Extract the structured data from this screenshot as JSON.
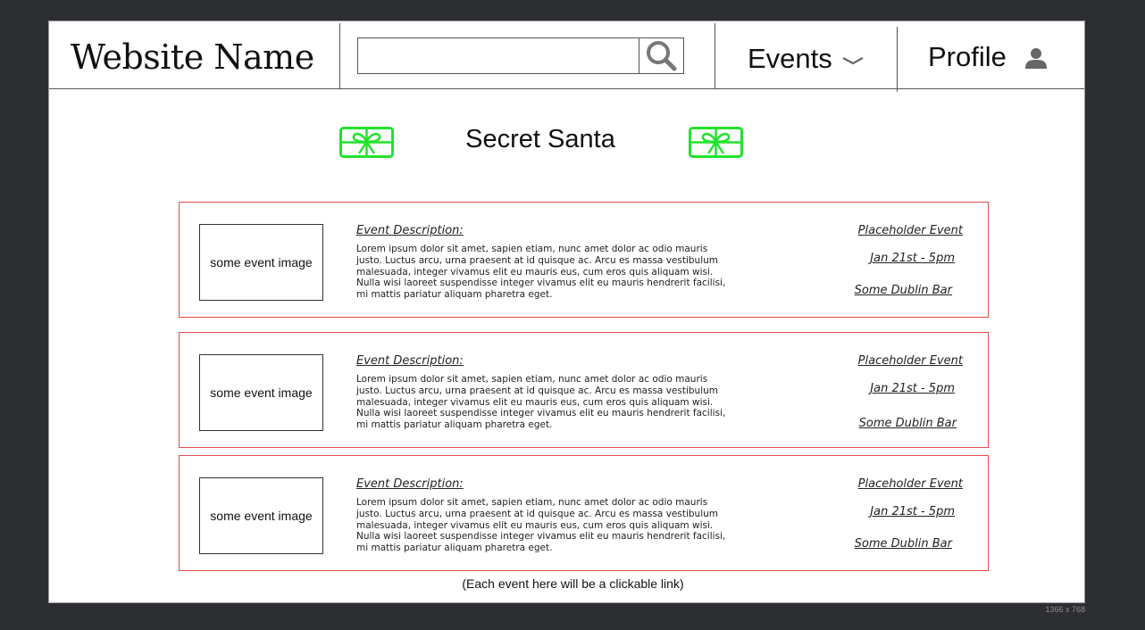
{
  "header": {
    "site_name": "Website Name",
    "search": {
      "value": "",
      "placeholder": "",
      "icon": "search-icon"
    },
    "events_label": "Events",
    "events_icon": "chevron-down-icon",
    "profile_label": "Profile",
    "profile_icon": "person-icon"
  },
  "hero": {
    "title": "Secret Santa",
    "icon": "gift-icon",
    "icon_color": "#22e32c"
  },
  "events": [
    {
      "image_label": "some event image",
      "description_title": "Event Description:",
      "description": "Lorem ipsum dolor sit amet, sapien etiam, nunc amet dolor ac odio mauris justo. Luctus arcu, urna praesent at id quisque ac. Arcu es massa vestibulum malesuada, integer vivamus elit eu mauris eus, cum eros quis aliquam wisi. Nulla wisi laoreet suspendisse integer vivamus elit eu mauris hendrerit facilisi, mi mattis pariatur aliquam pharetra eget.",
      "name": "Placeholder Event",
      "date": "Jan 21st - 5pm",
      "venue": "Some Dublin Bar"
    },
    {
      "image_label": "some event image",
      "description_title": "Event Description:",
      "description": "Lorem ipsum dolor sit amet, sapien etiam, nunc amet dolor ac odio mauris justo. Luctus arcu, urna praesent at id quisque ac. Arcu es massa vestibulum malesuada, integer vivamus elit eu mauris eus, cum eros quis aliquam wisi. Nulla wisi laoreet suspendisse integer vivamus elit eu mauris hendrerit facilisi, mi mattis pariatur aliquam pharetra eget.",
      "name": "Placeholder Event",
      "date": "Jan 21st - 5pm",
      "venue": "Some Dublin Bar"
    },
    {
      "image_label": "some event image",
      "description_title": "Event Description:",
      "description": "Lorem ipsum dolor sit amet, sapien etiam, nunc amet dolor ac odio mauris justo. Luctus arcu, urna praesent at id quisque ac. Arcu es massa vestibulum malesuada, integer vivamus elit eu mauris eus, cum eros quis aliquam wisi. Nulla wisi laoreet suspendisse integer vivamus elit eu mauris hendrerit facilisi, mi mattis pariatur aliquam pharetra eget.",
      "name": "Placeholder Event",
      "date": "Jan 21st - 5pm",
      "venue": "Some Dublin Bar"
    }
  ],
  "footnote": "(Each event here will be a clickable link)",
  "canvas_size_label": "1366 x 768",
  "colors": {
    "card_border": "#e04a4a",
    "gift_icon": "#22e32c",
    "backdrop": "#2d2e31"
  }
}
